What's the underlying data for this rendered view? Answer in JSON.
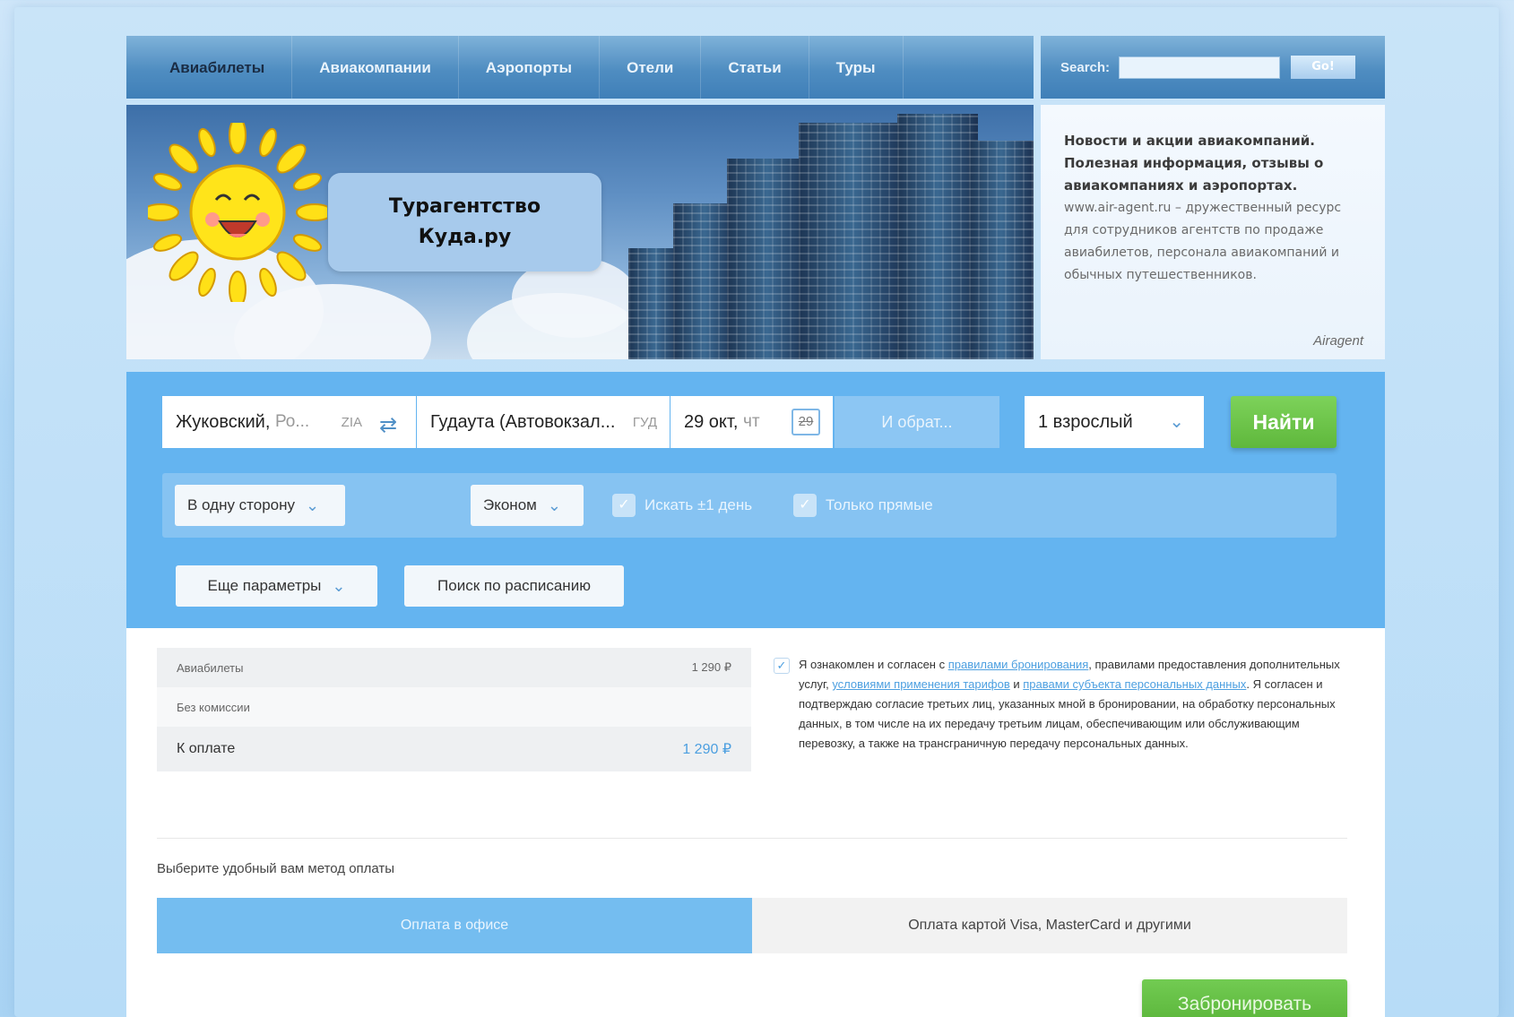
{
  "nav": {
    "items": [
      "Авиабилеты",
      "Авиакомпании",
      "Аэропорты",
      "Отели",
      "Статьи",
      "Туры"
    ]
  },
  "search": {
    "label": "Search:",
    "button": "Go!"
  },
  "banner": {
    "brand_line1": "Турагентство",
    "brand_line2": "Куда.ру"
  },
  "news": {
    "headline": "Новости и акции авиакомпаний. Полезная информация, отзывы о авиакомпаниях и аэропортах.",
    "body": "www.air-agent.ru – дружественный ресурс для сотрудников агентств по продаже авиабилетов, персонала авиакомпаний и обычных путешественников.",
    "signature": "Airagent"
  },
  "form": {
    "from_city": "Жуковский,",
    "from_rest": "Ро...",
    "from_code": "ZIA",
    "to_city": "Гудаута (Автовокзал...",
    "to_code": "ГУД",
    "date": "29 окт,",
    "date_weekday": "чт",
    "calendar_day": "29",
    "return_placeholder": "И обрат...",
    "passengers": "1 взрослый",
    "find_button": "Найти",
    "trip_type": "В одну сторону",
    "cabin_class": "Эконом",
    "flex_day": "Искать ±1 день",
    "direct_only": "Только прямые",
    "more_params": "Еще параметры",
    "schedule_search": "Поиск по расписанию"
  },
  "booking": {
    "rows": [
      {
        "label": "Авиабилеты",
        "value": "1 290 ₽"
      },
      {
        "label": "Без комиссии",
        "value": ""
      }
    ],
    "total_label": "К оплате",
    "total_value": "1 290 ₽",
    "consent": {
      "p1": "Я ознакомлен и согласен с ",
      "l1": "правилами бронирования",
      "p2": ", правилами предоставления дополнительных услуг, ",
      "l2": "условиями применения тарифов",
      "p3": " и ",
      "l3": "правами субъекта персональных данных",
      "p4": ". Я согласен и подтверждаю согласие третьих лиц, указанных мной в бронировании, на обработку персональных данных, в том числе на их передачу третьим лицам, обеспечивающим или обслуживающим перевозку, а также на трансграничную передачу персональных данных."
    },
    "pay_label": "Выберите удобный вам метод оплаты",
    "pay_office": "Оплата в офисе",
    "pay_card": "Оплата картой Visa, MasterCard и другими",
    "book_button": "Забронировать"
  }
}
